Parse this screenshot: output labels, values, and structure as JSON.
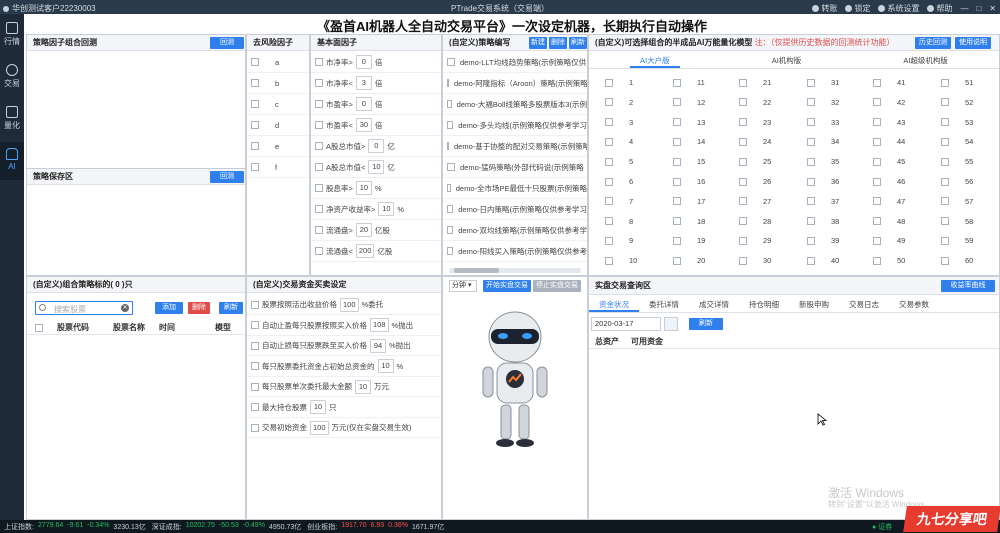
{
  "titlebar": {
    "account": "华创测试客户22230003",
    "app_title": "PTrade交易系统（交易端）",
    "actions": [
      "转账",
      "锁定",
      "系统设置",
      "帮助"
    ]
  },
  "sidebar": {
    "items": [
      "行情",
      "交易",
      "量化",
      "AI"
    ]
  },
  "page_title": "《盈首AI机器人全自动交易平台》一次设定机器，长期执行自动操作",
  "factor_backtest": {
    "title": "策略因子组合回测",
    "button": "回测"
  },
  "strategy_save": {
    "title": "策略保存区",
    "button": "回测"
  },
  "risk_factor": {
    "title": "去风险因子",
    "items": [
      "a",
      "b",
      "c",
      "d",
      "e",
      "f"
    ]
  },
  "basic_factor": {
    "title": "基本面因子",
    "items": [
      {
        "label": "市净率>",
        "value": "0",
        "unit": "倍"
      },
      {
        "label": "市净率<",
        "value": "3",
        "unit": "倍"
      },
      {
        "label": "市盈率>",
        "value": "0",
        "unit": "倍"
      },
      {
        "label": "市盈率<",
        "value": "30",
        "unit": "倍"
      },
      {
        "label": "A股总市值>",
        "value": "0",
        "unit": "亿"
      },
      {
        "label": "A股总市值<",
        "value": "10",
        "unit": "亿"
      },
      {
        "label": "股息率>",
        "value": "10",
        "unit": "%"
      },
      {
        "label": "净资产收益率>",
        "value": "10",
        "unit": "%"
      },
      {
        "label": "流通盘>",
        "value": "20",
        "unit": "亿股"
      },
      {
        "label": "流通盘<",
        "value": "200",
        "unit": "亿股"
      }
    ]
  },
  "strategy_edit": {
    "title": "(自定义)策略编写",
    "buttons": [
      "新建",
      "删除",
      "刷新"
    ],
    "items": [
      "demo-LLT均线趋势策略(示例策略仅供",
      "demo-阿隆指标（Aroon）策略(示例策略",
      "demo-大福Boll线策略多股票版本3(示例",
      "demo-多头均线(示例策略仅供参考学习",
      "demo-基于协整的配对交易策略(示例策略",
      "demo-猛码策略(外部代码说(示例策略",
      "demo-全市场PE最低十只股票(示例策略",
      "demo-日内策略(示例策略仅供参考学习",
      "demo-双均线策略(示例策略仅供参考学",
      "demo-阳线买入策略(示例策略仅供参考"
    ]
  },
  "ai_model": {
    "title": "(自定义)可选择组合的半成品AI万能量化模型",
    "note": "注：（仅提供历史数据的回测统计功能）",
    "buttons": [
      "历史回测",
      "使用说明"
    ],
    "tabs": [
      "AI大户版",
      "AI机构版",
      "AI超级机构版"
    ],
    "numbers": [
      1,
      11,
      21,
      31,
      41,
      51,
      2,
      12,
      22,
      32,
      42,
      52,
      3,
      13,
      23,
      33,
      43,
      53,
      4,
      14,
      24,
      34,
      44,
      54,
      5,
      15,
      25,
      35,
      45,
      55,
      6,
      16,
      26,
      36,
      46,
      56,
      7,
      17,
      27,
      37,
      47,
      57,
      8,
      18,
      28,
      38,
      48,
      58,
      9,
      19,
      29,
      39,
      49,
      59,
      10,
      20,
      30,
      40,
      50,
      60
    ]
  },
  "stock_list": {
    "title_prefix": "(自定义)组合策略标的(",
    "count": "0",
    "title_suffix": ")只",
    "search_placeholder": "搜索股票",
    "buttons": [
      "添加",
      "删除",
      "刷新"
    ],
    "columns": [
      "股票代码",
      "股票名称",
      "时间",
      "模型"
    ]
  },
  "fund_settings": {
    "title": "(自定义)交易资金买卖设定",
    "items": [
      {
        "label": "股票按照活出收益价格",
        "value": "100",
        "unit": "%委托"
      },
      {
        "label": "自动止盈每只股票按照买入价格",
        "value": "108",
        "unit": "%抛出"
      },
      {
        "label": "自动止损每只股票跌至买入价格",
        "value": "94",
        "unit": "%抛出"
      },
      {
        "label": "每只股票委托资金占初始总资金的",
        "value": "10",
        "unit": "%"
      },
      {
        "label": "每只股票单次委托最大金额",
        "value": "10",
        "unit": "万元"
      },
      {
        "label": "最大持仓股票",
        "value": "10",
        "unit": "只"
      },
      {
        "label": "交易初始资金",
        "value": "100",
        "unit": "万元(仅在实盘交易生效)"
      }
    ]
  },
  "robot_panel": {
    "select": "分钟",
    "buttons": [
      "开始实盘交易",
      "停止实盘交易"
    ]
  },
  "live_query": {
    "title": "实盘交易查询区",
    "button": "收益率曲线",
    "tabs": [
      "资金状况",
      "委托详情",
      "成交详情",
      "持仓明细",
      "新股申购",
      "交易日志",
      "交易参数"
    ],
    "date": "2020-03-17",
    "refresh": "刷新",
    "columns": [
      "总资产",
      "可用资金"
    ]
  },
  "statusbar": [
    {
      "label": "上证指数:",
      "value": "2779.64",
      "chg": "-9.61",
      "pct": "-0.34%",
      "vol": "3230.13亿",
      "color": "g"
    },
    {
      "label": "深证成指:",
      "value": "10202.75",
      "chg": "-50.53",
      "pct": "-0.49%",
      "vol": "4950.73亿",
      "color": "g"
    },
    {
      "label": "创业板指:",
      "value": "1917.70",
      "chg": "6.93",
      "pct": "0.36%",
      "vol": "1671.97亿",
      "color": "r"
    }
  ],
  "status_right": "证券",
  "watermark": {
    "line1": "激活 Windows",
    "line2": "转到\"设置\"以激活 Windows。"
  },
  "logo_text": "九七分享吧"
}
